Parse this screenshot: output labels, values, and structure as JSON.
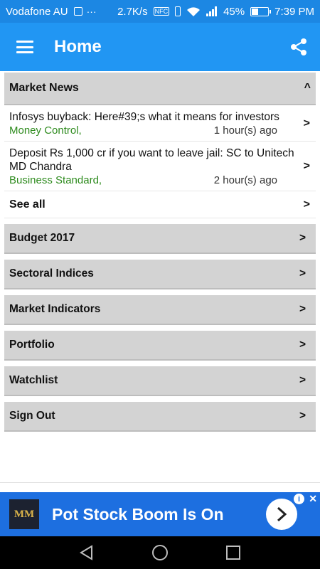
{
  "status_bar": {
    "carrier": "Vodafone AU",
    "net_speed": "2.7K/s",
    "battery_percent": "45%",
    "battery_level": 0.45,
    "time": "7:39 PM",
    "nfc_label": "NFC"
  },
  "app_bar": {
    "title": "Home",
    "menu_icon": "hamburger-menu-icon",
    "share_icon": "share-icon"
  },
  "market_news": {
    "header": "Market News",
    "collapse_glyph": "^",
    "items": [
      {
        "title": "Infosys buyback: Here#39;s what it means for investors",
        "source": "Money Control,",
        "time": "1 hour(s) ago",
        "arrow": ">"
      },
      {
        "title": "Deposit Rs 1,000 cr if you want to leave jail: SC to Unitech MD Chandra",
        "source": "Business Standard,",
        "time": "2 hour(s) ago",
        "arrow": ">"
      }
    ],
    "see_all": "See all",
    "see_all_arrow": ">"
  },
  "menu": [
    {
      "label": "Budget 2017",
      "arrow": ">"
    },
    {
      "label": "Sectoral Indices",
      "arrow": ">"
    },
    {
      "label": "Market Indicators",
      "arrow": ">"
    },
    {
      "label": "Portfolio",
      "arrow": ">"
    },
    {
      "label": "Watchlist",
      "arrow": ">"
    },
    {
      "label": "Sign Out",
      "arrow": ">"
    }
  ],
  "ad": {
    "logo_text": "MM",
    "text": "Pot Stock Boom Is On",
    "info_glyph": "i",
    "close_glyph": "✕",
    "background": "#1d6fe0"
  },
  "colors": {
    "status_bar": "#1c87e3",
    "app_bar": "#2196f3",
    "row_background": "#d3d3d3",
    "source_text": "#2e8b1e"
  }
}
